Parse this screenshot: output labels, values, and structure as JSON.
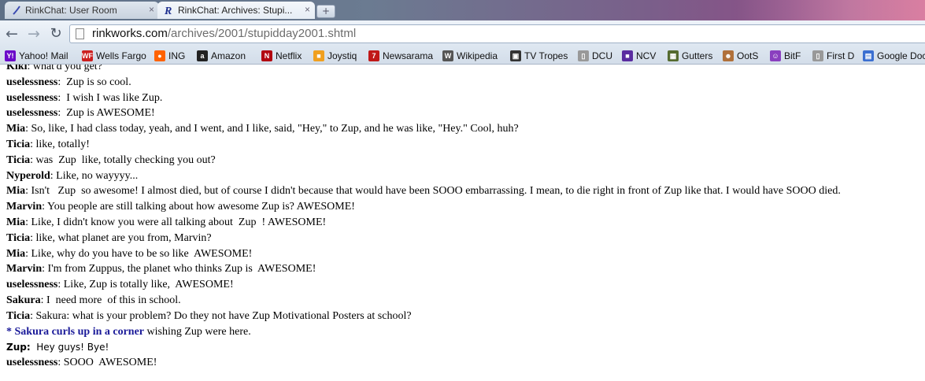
{
  "browser": {
    "tabs": [
      {
        "title": "RinkChat: User Room"
      },
      {
        "title": "RinkChat: Archives: Stupi..."
      }
    ],
    "close_glyph": "×",
    "new_tab_glyph": "+",
    "address": {
      "host": "rinkworks.com",
      "path": "/archives/2001/stupidday2001.shtml"
    },
    "bookmarks": [
      {
        "label": "Yahoo! Mail",
        "icon": "Y!",
        "color": "#6b0ac9"
      },
      {
        "label": "Wells Fargo",
        "icon": "WF",
        "color": "#cc1f1f"
      },
      {
        "label": "ING",
        "icon": "●",
        "color": "#ff6200"
      },
      {
        "label": "Amazon",
        "icon": "a",
        "color": "#222222"
      },
      {
        "label": "Netflix",
        "icon": "N",
        "color": "#b20710"
      },
      {
        "label": "Joystiq",
        "icon": "■",
        "color": "#f0a020"
      },
      {
        "label": "Newsarama",
        "icon": "7",
        "color": "#c01818"
      },
      {
        "label": "Wikipedia",
        "icon": "W",
        "color": "#555555"
      },
      {
        "label": "TV Tropes",
        "icon": "▣",
        "color": "#333333"
      },
      {
        "label": "DCU",
        "icon": "▯",
        "color": "#999999"
      },
      {
        "label": "NCV",
        "icon": "■",
        "color": "#5a2ca0"
      },
      {
        "label": "Gutters",
        "icon": "▦",
        "color": "#556b2f"
      },
      {
        "label": "OotS",
        "icon": "☻",
        "color": "#b0703a"
      },
      {
        "label": "BitF",
        "icon": "☺",
        "color": "#8a3fbf"
      },
      {
        "label": "First D",
        "icon": "▯",
        "color": "#999999"
      },
      {
        "label": "Google Doc",
        "icon": "▤",
        "color": "#3b6fd1"
      }
    ]
  },
  "chat": [
    {
      "speaker": "Kiki",
      "sep": ":",
      "text": " what'd you get?"
    },
    {
      "speaker": "uselessness",
      "sep": ":",
      "text": "  Zup is so cool."
    },
    {
      "speaker": "uselessness",
      "sep": ":",
      "text": "  I wish I was like Zup."
    },
    {
      "speaker": "uselessness",
      "sep": ":",
      "text": "  Zup is AWESOME!"
    },
    {
      "speaker": "Mia",
      "sep": ":",
      "text": " So, like, I had class today, yeah, and I went, and I like, said, \"Hey,\" to Zup, and he was like, \"Hey.\" Cool, huh?"
    },
    {
      "speaker": "Ticia",
      "sep": ":",
      "text": " like, totally!"
    },
    {
      "speaker": "Ticia",
      "sep": ":",
      "text": " was  Zup  like, totally checking you out?"
    },
    {
      "speaker": "Nyperold",
      "sep": ":",
      "text": " Like, no wayyyy..."
    },
    {
      "speaker": "Mia",
      "sep": ":",
      "text": " Isn't   Zup  so awesome! I almost died, but of course I didn't because that would have been SOOO embarrassing. I mean, to die right in front of Zup like that. I would have SOOO died."
    },
    {
      "speaker": "Marvin",
      "sep": ":",
      "text": " You people are still talking about how awesome Zup is? AWESOME!"
    },
    {
      "speaker": "Mia",
      "sep": ":",
      "text": " Like, I didn't know you were all talking about  Zup  ! AWESOME!"
    },
    {
      "speaker": "Ticia",
      "sep": ":",
      "text": " like, what planet are you from, Marvin?"
    },
    {
      "speaker": "Mia",
      "sep": ":",
      "text": " Like, why do you have to be so like  AWESOME!"
    },
    {
      "speaker": "Marvin",
      "sep": ":",
      "text": " I'm from Zuppus, the planet who thinks Zup is  AWESOME!"
    },
    {
      "speaker": "uselessness",
      "sep": ":",
      "text": " Like, Zup is totally like,  AWESOME!"
    },
    {
      "speaker": "Sakura",
      "sep": ":",
      "text": " I  need more  of this in school."
    },
    {
      "speaker": "Ticia",
      "sep": ":",
      "text": " Sakura: what is your problem? Do they not have Zup Motivational Posters at school?"
    },
    {
      "speaker": "* Sakura curls up in a corner",
      "sep": "",
      "text": " wishing Zup were here.",
      "action": true
    },
    {
      "speaker": " Zup:",
      "sep": "",
      "text": "  Hey guys! Bye!",
      "small": true
    },
    {
      "speaker": "uselessness",
      "sep": ":",
      "text": " SOOO  AWESOME!"
    }
  ]
}
